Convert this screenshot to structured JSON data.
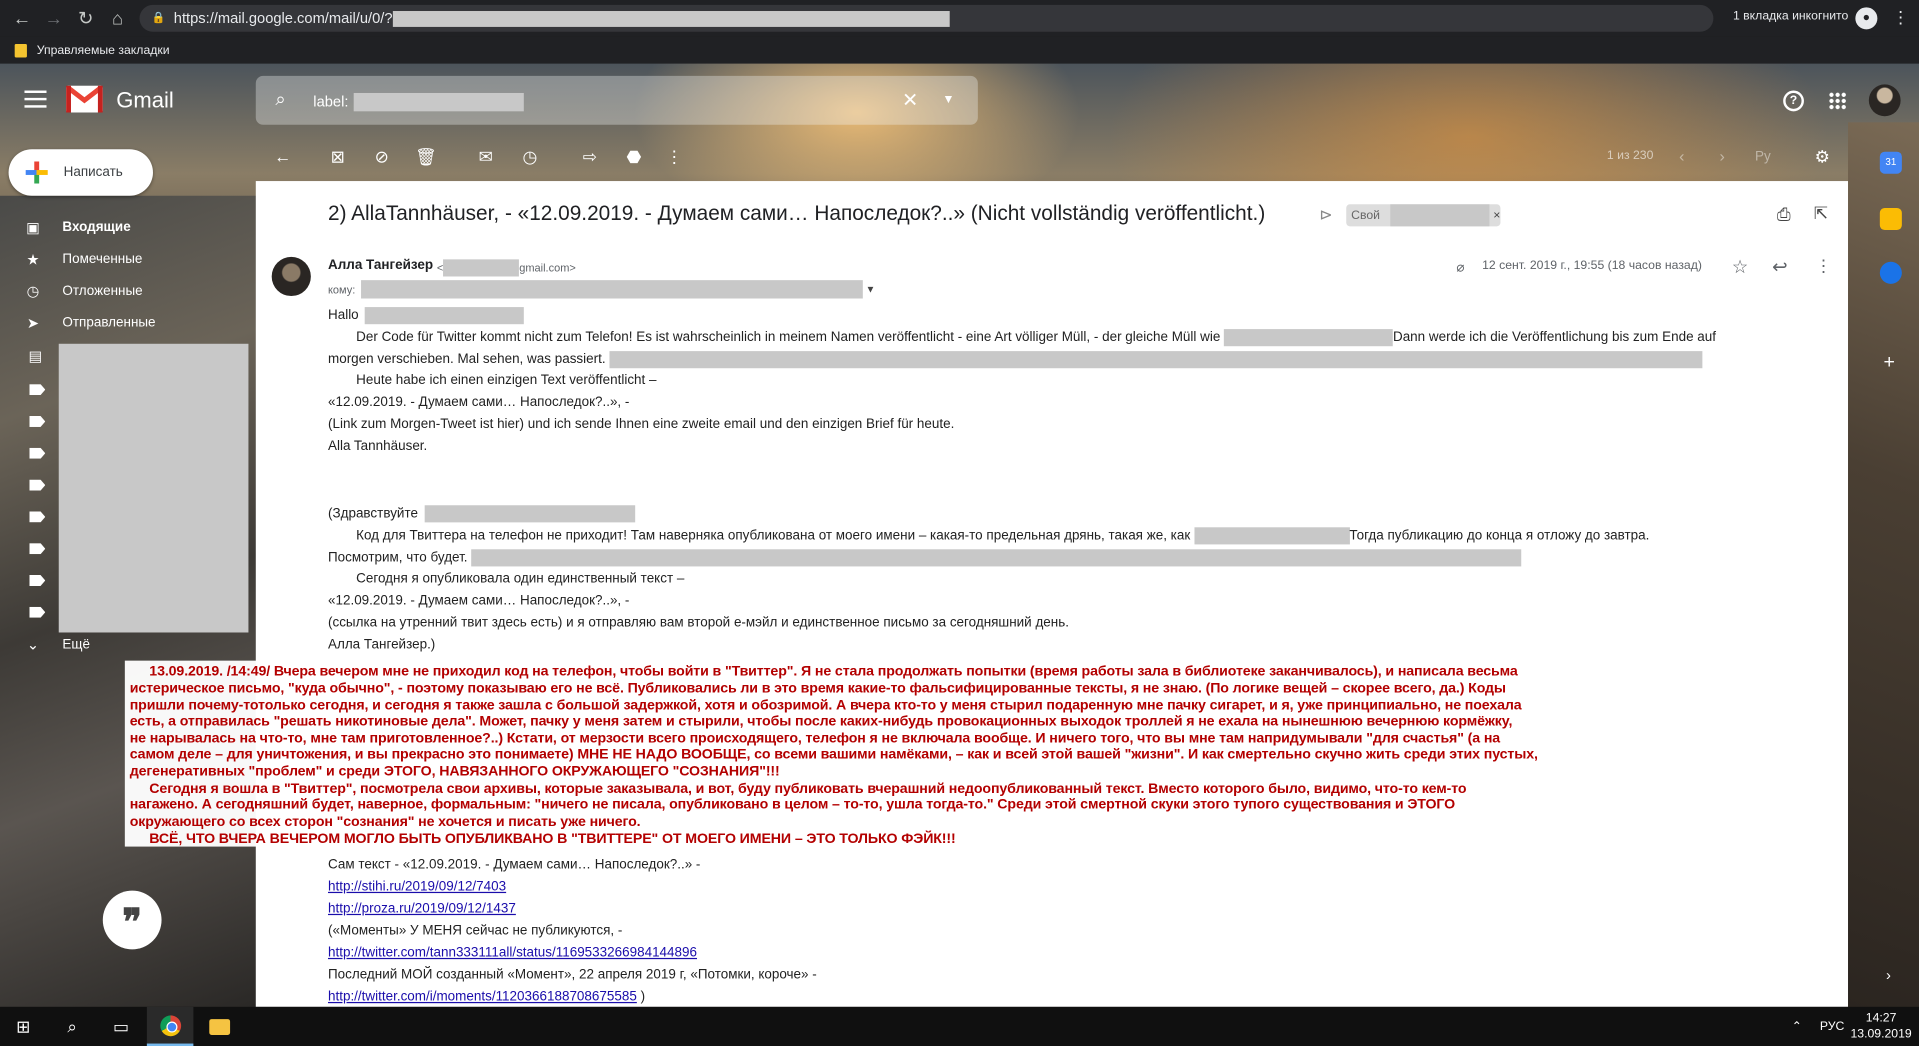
{
  "browser": {
    "url": "https://mail.google.com/mail/u/0/?",
    "incognito_label": "1 вкладка инкогнито",
    "bookmarks_label": "Управляемые закладки"
  },
  "gmail": {
    "product": "Gmail",
    "search_prefix": "label:",
    "compose_label": "Написать",
    "sidebar": [
      {
        "label": "Входящие",
        "icon": "inbox-icon"
      },
      {
        "label": "Помеченные",
        "icon": "star-icon"
      },
      {
        "label": "Отложенные",
        "icon": "clock-icon"
      },
      {
        "label": "Отправленные",
        "icon": "send-icon"
      }
    ],
    "sidebar_more": "Ещё",
    "pager_text": "1 из 230",
    "lang_indicator": "Ру"
  },
  "email": {
    "subject": "2) AllaTannhäuser, - «12.09.2019. - Думаем сами… Напоследок?..» (Nicht vollständig veröffentlicht.)",
    "label_chip": "Свой",
    "sender_name": "Алла Тангейзер",
    "sender_email_prefix": "<",
    "sender_email_suffix": "gmail.com>",
    "to_label": "кому:",
    "date": "12 сент. 2019 г., 19:55 (18 часов назад)",
    "body": {
      "greeting_de": "Hallo",
      "p1_a": "Der Code für Twitter kommt nicht zum Telefon! Es ist wahrscheinlich in meinem Namen veröffentlicht - eine Art völliger Müll, - der gleiche Müll wie",
      "p1_b": "Dann werde ich die Veröffentlichung bis zum Ende auf",
      "p1_c": "morgen verschieben. Mal sehen, was passiert.",
      "p2": "Heute habe ich einen einzigen Text veröffentlicht –",
      "p3": "«12.09.2019. - Думаем сами… Напоследок?..», -",
      "p4": "(Link zum Morgen-Tweet ist hier) und ich sende Ihnen eine zweite email und den einzigen Brief für heute.",
      "sig_de": "Alla Tannhäuser.",
      "greeting_ru": "(Здравствуйте",
      "r1_a": "Код для Твиттера на телефон не приходит! Там наверняка опубликована от моего имени – какая-то предельная дрянь, такая же, как",
      "r1_b": "Тогда публикацию до конца я отложу до завтра.",
      "r1_c": "Посмотрим, что будет.",
      "r2": "Сегодня я опубликовала один единственный текст –",
      "r3": "«12.09.2019. - Думаем сами… Напоследок?..», -",
      "r4": "(ссылка на утренний твит здесь есть) и я отправляю вам второй е-мэйл и единственное письмо за сегодняшний день.",
      "sig_ru": "Алла Тангейзер.)",
      "text_label": "Сам текст - «12.09.2019. - Думаем сами… Напоследок?..» -",
      "link1": "http://stihi.ru/2019/09/12/7403",
      "link2": "http://proza.ru/2019/09/12/1437",
      "moments": "(«Моменты» У МЕНЯ сейчас не публикуются, -",
      "link3": "http://twitter.com/tann333111all/status/1169533266984144896",
      "last_moment": "Последний МОЙ созданный «Момент», 22 апреля 2019 г, «Потомки, короче» -",
      "link4": "http://twitter.com/i/moments/1120366188708675585",
      "link4_tail": ")"
    }
  },
  "overlay": {
    "lines": [
      "13.09.2019. /14:49/ Вчера вечером мне не приходил код на телефон, чтобы войти в \"Твиттер\". Я не стала продолжать попытки (время работы зала в библиотеке заканчивалось), и написала весьма",
      "истерическое письмо, \"куда обычно\", -  поэтому показываю его не всё. Публиковались ли в это время какие-то фальсифицированные тексты, я не знаю. (По логике вещей – скорее всего, да.) Коды",
      "пришли почему-тотолько сегодня, и сегодня я также зашла с большой задержкой, хотя и обозримой. А вчера кто-то у меня стырил подаренную мне пачку сигарет, и я, уже принципиально, не поехала",
      "есть, а отправилась \"решать никотиновые дела\". Может, пачку у меня затем и стырили, чтобы после каких-нибудь провокационных выходок троллей я не ехала на нынешнюю вечернюю кормёжку,",
      "не нарывалась на что-то, мне там приготовленное?..) Кстати, от мерзости всего происходящего, телефон я не включала вообще. И ничего того, что вы мне там напридумывали \"для счастья\" (а на",
      "самом деле – для уничтожения, и вы прекрасно это понимаете) МНЕ НЕ НАДО ВООБЩЕ, со всеми вашими намёками, – как и всей этой вашей \"жизни\". И как смертельно скучно жить среди этих пустых,",
      "дегенеративных \"проблем\" и среди ЭТОГО, НАВЯЗАННОГО ОКРУЖАЮЩЕГО \"СОЗНАНИЯ\"!!!",
      "Сегодня я вошла в \"Твиттер\", посмотрела свои архивы, которые заказывала, и вот, буду публиковать вчерашний недоопубликованный текст.  Вместо которого было, видимо, что-то кем-то",
      "нагажено. А сегодняшний будет,  наверное, формальным: \"ничего не писала, опубликовано в целом – то-то, ушла тогда-то.\" Среди этой смертной скуки этого тупого существования и ЭТОГО",
      "окружающего со всех сторон \"сознания\" не хочется и писать уже ничего.",
      "ВСЁ, ЧТО ВЧЕРА ВЕЧЕРОМ МОГЛО БЫТЬ ОПУБЛИКВАНО В \"ТВИТТЕРЕ\" ОТ МОЕГО ИМЕНИ – ЭТО ТОЛЬКО ФЭЙК!!!"
    ]
  },
  "taskbar": {
    "lang": "РУС",
    "time": "14:27",
    "date": "13.09.2019"
  },
  "colors": {
    "overlay_text": "#b30000",
    "link": "#1a0dab",
    "redaction": "#c8c8c8"
  }
}
